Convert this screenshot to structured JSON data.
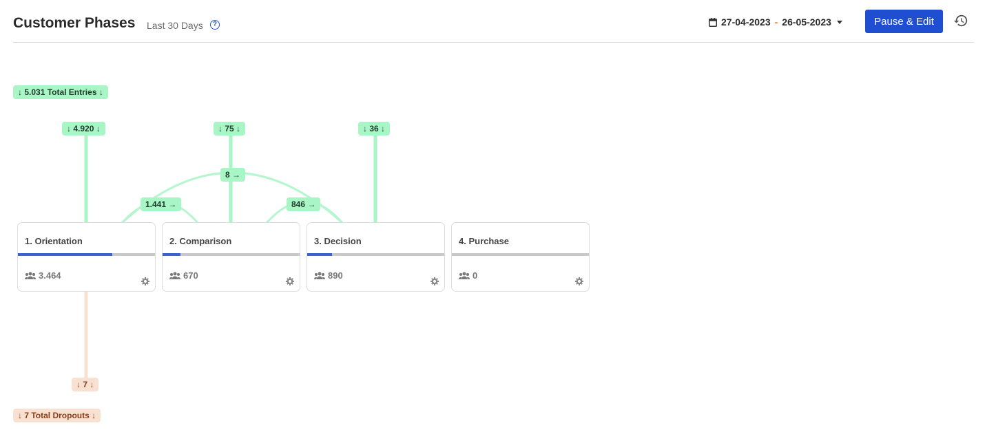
{
  "header": {
    "title": "Customer Phases",
    "subtitle": "Last 30 Days",
    "help_icon": "?",
    "date_start": "27-04-2023",
    "date_sep": "-",
    "date_end": "26-05-2023",
    "primary_button": "Pause & Edit"
  },
  "flow": {
    "total_entries": "↓ 5.031 Total Entries ↓",
    "entries": [
      "↓ 4.920 ↓",
      "↓ 75 ↓",
      "↓ 36 ↓"
    ],
    "transitions": [
      "1.441 →",
      "8 →",
      "846 →"
    ],
    "dropout": "↓ 7 ↓",
    "total_dropouts": "↓ 7 Total Dropouts ↓"
  },
  "phases": [
    {
      "title": "1. Orientation",
      "count": "3.464",
      "progress": 0.69
    },
    {
      "title": "2. Comparison",
      "count": "670",
      "progress": 0.13
    },
    {
      "title": "3. Decision",
      "count": "890",
      "progress": 0.18
    },
    {
      "title": "4. Purchase",
      "count": "0",
      "progress": 0
    }
  ],
  "colors": {
    "accent": "#1f4fd0",
    "flow_green": "#a8f5c6",
    "flow_peach": "#f9e1d2",
    "progress_blue": "#3a63d1"
  },
  "icons": [
    "calendar-icon",
    "caret-down-icon",
    "history-icon",
    "help-icon",
    "users-icon",
    "gear-icon"
  ]
}
